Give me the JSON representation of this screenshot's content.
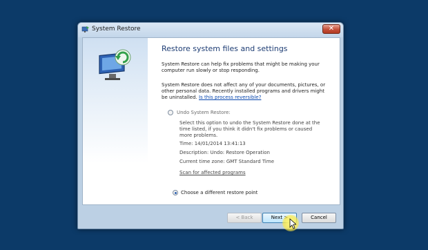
{
  "window": {
    "title": "System Restore",
    "close_glyph": "✕"
  },
  "heading": "Restore system files and settings",
  "intro": "System Restore can help fix problems that might be making your computer run slowly or stop responding.",
  "note": "System Restore does not affect any of your documents, pictures, or other personal data. Recently installed programs and drivers might be uninstalled.",
  "note_link": "Is this process reversible?",
  "options": {
    "undo": {
      "label": "Undo System Restore:",
      "selected": false,
      "description": "Select this option to undo the System Restore done at the time listed, if you think it didn't fix problems or caused more problems.",
      "time": "Time: 14/01/2014 13:41:13",
      "restore_description": "Description: Undo: Restore Operation",
      "timezone": "Current time zone: GMT Standard Time",
      "scan_link": "Scan for affected programs"
    },
    "choose": {
      "label": "Choose a different restore point",
      "selected": true
    }
  },
  "buttons": {
    "back": "< Back",
    "next": "Next >",
    "cancel": "Cancel"
  },
  "icons": {
    "side": "system-restore-monitor-icon",
    "title": "system-restore-icon"
  },
  "colors": {
    "desktop": "#0c3a68",
    "heading": "#1e3d74",
    "link": "#0645ad",
    "close": "#c4503a"
  }
}
